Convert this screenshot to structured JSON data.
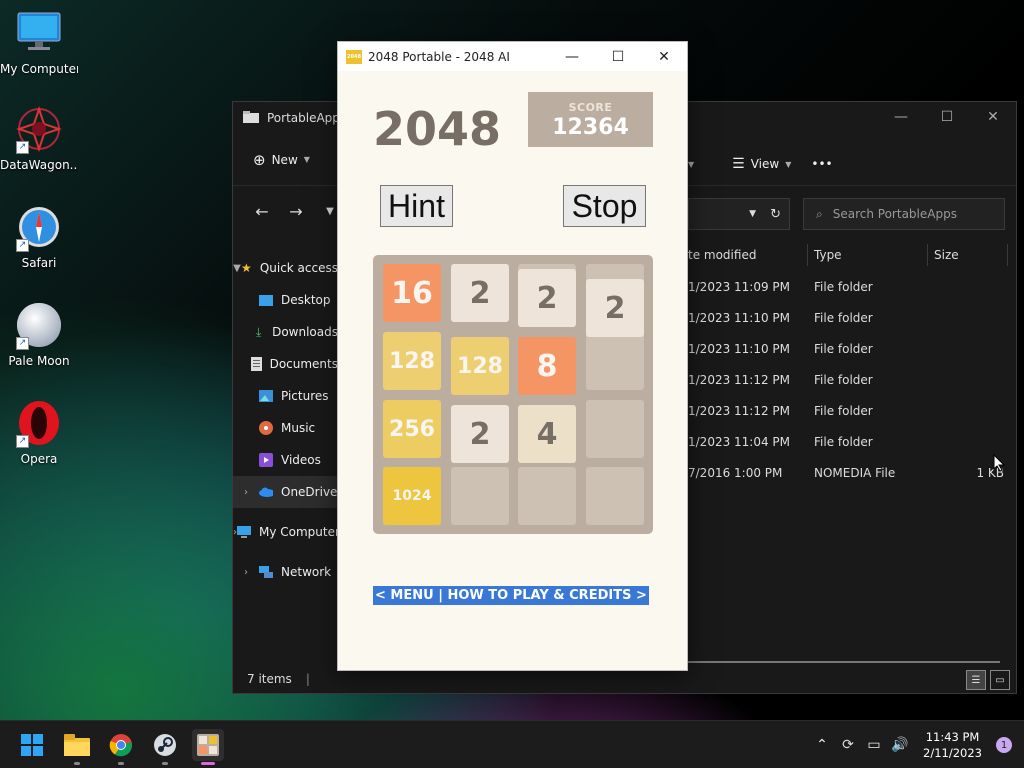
{
  "desktop": {
    "icons": [
      {
        "label": "My Computer",
        "icon": "monitor-icon"
      },
      {
        "label": "DataWagon...",
        "icon": "datawagon-icon"
      },
      {
        "label": "Safari",
        "icon": "safari-compass-icon"
      },
      {
        "label": "Pale Moon",
        "icon": "pale-moon-icon"
      },
      {
        "label": "Opera",
        "icon": "opera-icon"
      }
    ]
  },
  "explorer": {
    "title": "PortableApps",
    "toolbar": {
      "new_label": "New",
      "view_label": "View",
      "more_label": "•••"
    },
    "search_placeholder": "Search PortableApps",
    "sidebar": [
      {
        "label": "Quick access",
        "icon": "star-icon"
      },
      {
        "label": "Desktop",
        "icon": "desktop-icon"
      },
      {
        "label": "Downloads",
        "icon": "download-icon"
      },
      {
        "label": "Documents",
        "icon": "document-icon"
      },
      {
        "label": "Pictures",
        "icon": "pictures-icon"
      },
      {
        "label": "Music",
        "icon": "music-icon"
      },
      {
        "label": "Videos",
        "icon": "videos-icon"
      },
      {
        "label": "OneDrive",
        "icon": "cloud-icon"
      },
      {
        "label": "My Computer",
        "icon": "monitor-icon"
      },
      {
        "label": "Network",
        "icon": "network-icon"
      }
    ],
    "columns": {
      "modified": "te modified",
      "type": "Type",
      "size": "Size"
    },
    "rows": [
      {
        "modified": "1/2023 11:09 PM",
        "type": "File folder",
        "size": ""
      },
      {
        "modified": "1/2023 11:10 PM",
        "type": "File folder",
        "size": ""
      },
      {
        "modified": "1/2023 11:10 PM",
        "type": "File folder",
        "size": ""
      },
      {
        "modified": "1/2023 11:12 PM",
        "type": "File folder",
        "size": ""
      },
      {
        "modified": "1/2023 11:12 PM",
        "type": "File folder",
        "size": ""
      },
      {
        "modified": "1/2023 11:04 PM",
        "type": "File folder",
        "size": ""
      },
      {
        "modified": "7/2016 1:00 PM",
        "type": "NOMEDIA File",
        "size": "1 KB"
      }
    ],
    "status": "7 items"
  },
  "game": {
    "window_title": "2048 Portable - 2048 AI",
    "app_icon_text": "2048",
    "heading": "2048",
    "score_label": "SCORE",
    "score_value": "12364",
    "hint_label": "Hint",
    "stop_label": "Stop",
    "menu_link": "< MENU | HOW TO PLAY & CREDITS >",
    "grid": [
      [
        "16",
        "2",
        "2",
        "2"
      ],
      [
        "128",
        "128",
        "8",
        ""
      ],
      [
        "256",
        "2",
        "4",
        ""
      ],
      [
        "1024",
        "",
        "",
        ""
      ]
    ]
  },
  "taskbar": {
    "apps": [
      "windows-start-icon",
      "file-explorer-icon",
      "chrome-icon",
      "steam-icon",
      "2048-app-icon"
    ],
    "time": "11:43 PM",
    "date": "2/11/2023",
    "notifications": "1"
  }
}
